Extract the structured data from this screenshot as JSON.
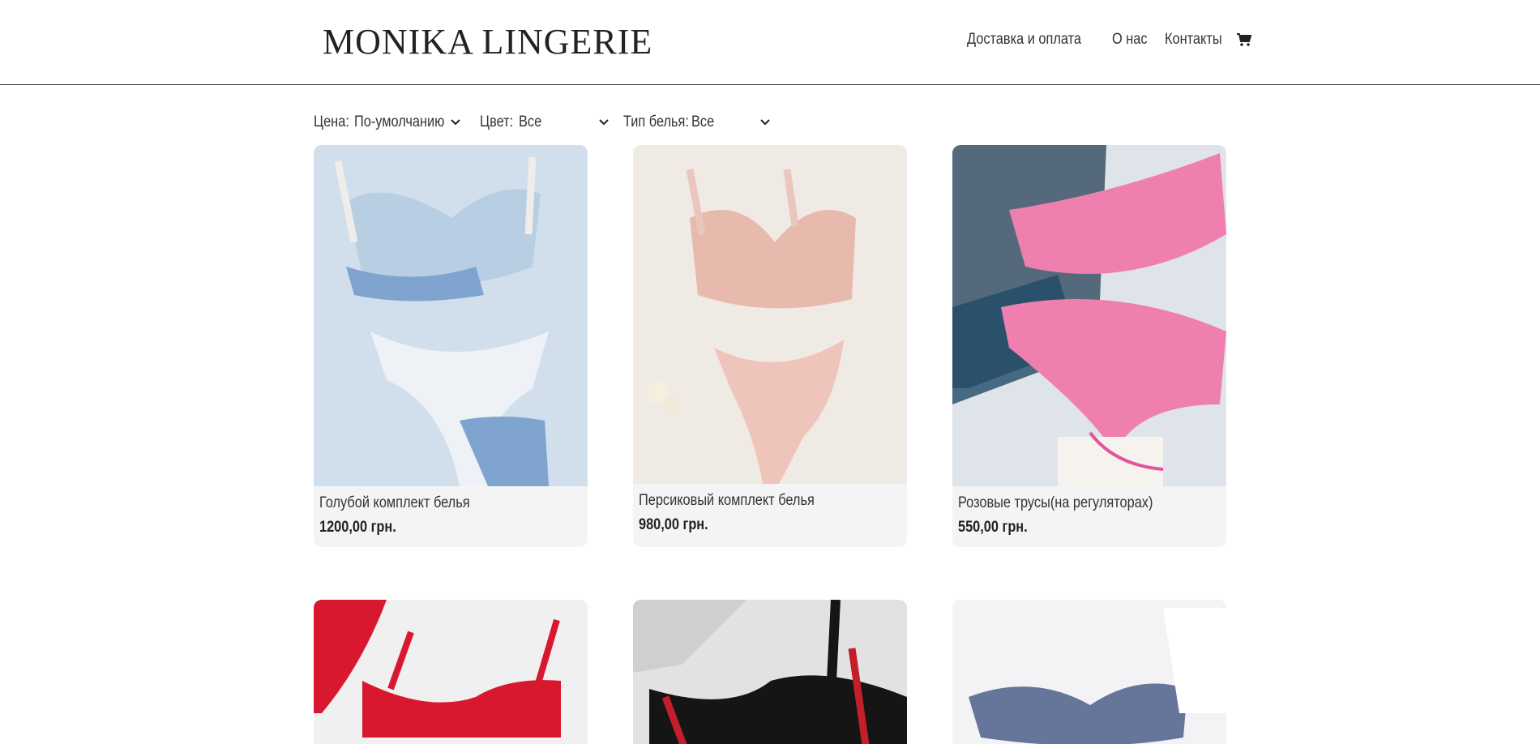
{
  "header": {
    "logo": "MONIKA LINGERIE",
    "nav": [
      {
        "label": "Доставка и оплата"
      },
      {
        "label": "О нас"
      },
      {
        "label": "Контакты"
      }
    ],
    "cart_icon": "cart-icon"
  },
  "filters": [
    {
      "label": "Цена:",
      "value": "По-умолчанию"
    },
    {
      "label": "Цвет:",
      "value": "Все"
    },
    {
      "label": "Тип белья:",
      "value": "Все"
    }
  ],
  "products": [
    {
      "title": "Голубой комплект белья",
      "price": "1200,00 грн.",
      "bg": "#c6d6e6",
      "accent": "#7fa4cf"
    },
    {
      "title": "Персиковый комплект белья",
      "price": "980,00 грн.",
      "bg": "#ece6e2",
      "accent": "#e8b9ad"
    },
    {
      "title": "Розовые трусы(на регуляторах)",
      "price": "550,00 грн.",
      "bg": "#dfe3ea",
      "accent": "#ef7fae"
    },
    {
      "title": "",
      "price": "",
      "bg": "#f0f0f0",
      "accent": "#d8182e"
    },
    {
      "title": "",
      "price": "",
      "bg": "#e2e2e2",
      "accent": "#151515"
    },
    {
      "title": "",
      "price": "",
      "bg": "#f3f3f5",
      "accent": "#2a3f73"
    }
  ]
}
